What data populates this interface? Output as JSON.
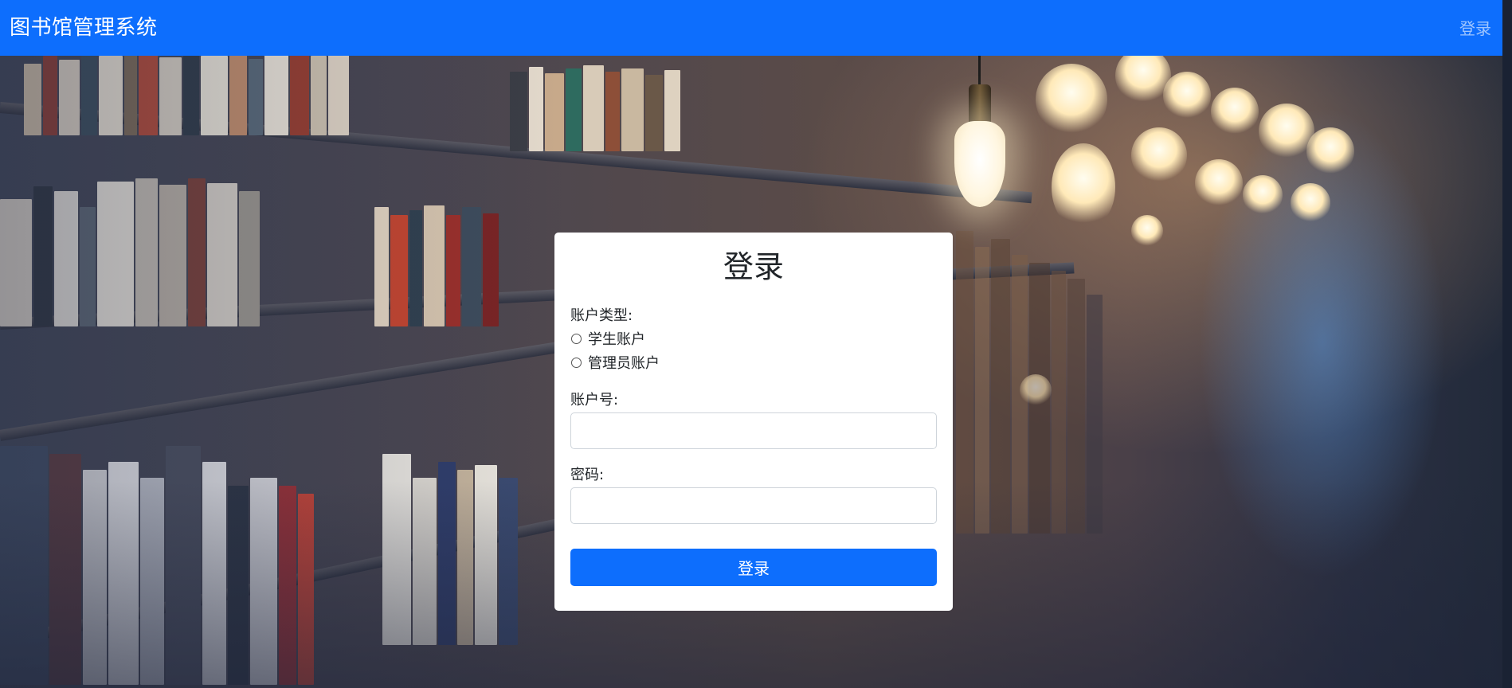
{
  "navbar": {
    "brand": "图书馆管理系统",
    "login_link": "登录"
  },
  "login_form": {
    "title": "登录",
    "account_type_label": "账户类型:",
    "account_types": [
      {
        "label": "学生账户",
        "selected": false
      },
      {
        "label": "管理员账户",
        "selected": false
      }
    ],
    "account_label": "账户号:",
    "account_value": "",
    "password_label": "密码:",
    "password_value": "",
    "submit_label": "登录"
  },
  "colors": {
    "primary": "#0d6efd",
    "card_bg": "#ffffff",
    "text": "#212529"
  }
}
